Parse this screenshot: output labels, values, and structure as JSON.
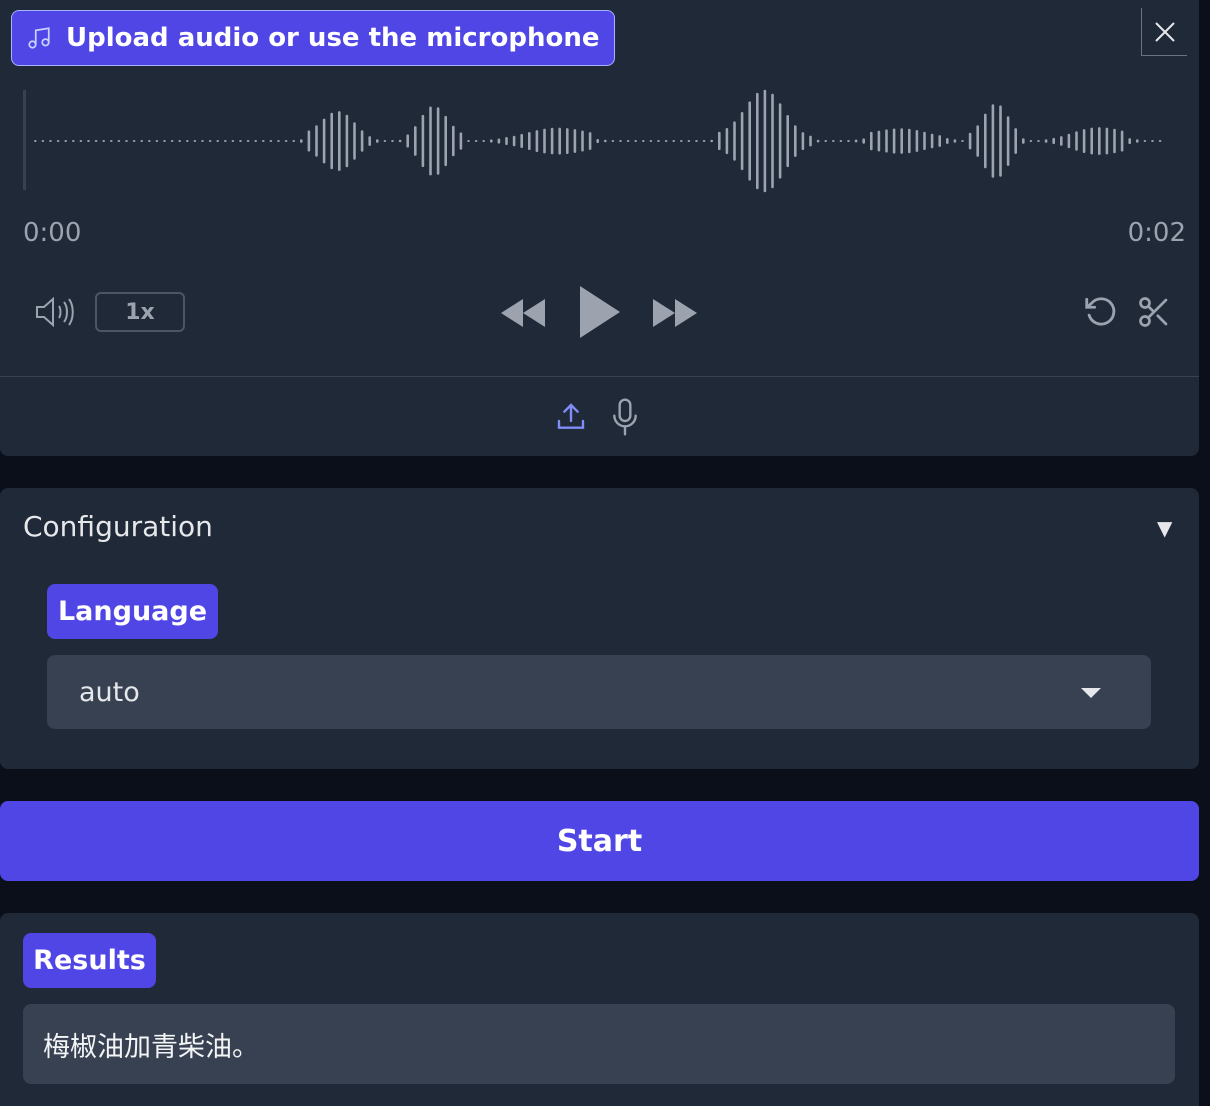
{
  "audio": {
    "label": "Upload audio or use the microphone",
    "time_current": "0:00",
    "time_total": "0:02",
    "speed": "1x",
    "icons": [
      "music-icon",
      "close-icon",
      "volume-icon",
      "rewind-icon",
      "play-icon",
      "fast-forward-icon",
      "undo-icon",
      "scissors-icon",
      "upload-icon",
      "microphone-icon"
    ]
  },
  "config": {
    "title": "Configuration",
    "toggle": "▼",
    "language_label": "Language",
    "language_value": "auto"
  },
  "start_label": "Start",
  "results": {
    "label": "Results",
    "text": "梅椒油加青柴油。"
  },
  "colors": {
    "accent": "#4f46e5",
    "panel": "#1f2937",
    "background": "#0b0f19",
    "field": "#374151",
    "muted": "#9ca3af"
  }
}
